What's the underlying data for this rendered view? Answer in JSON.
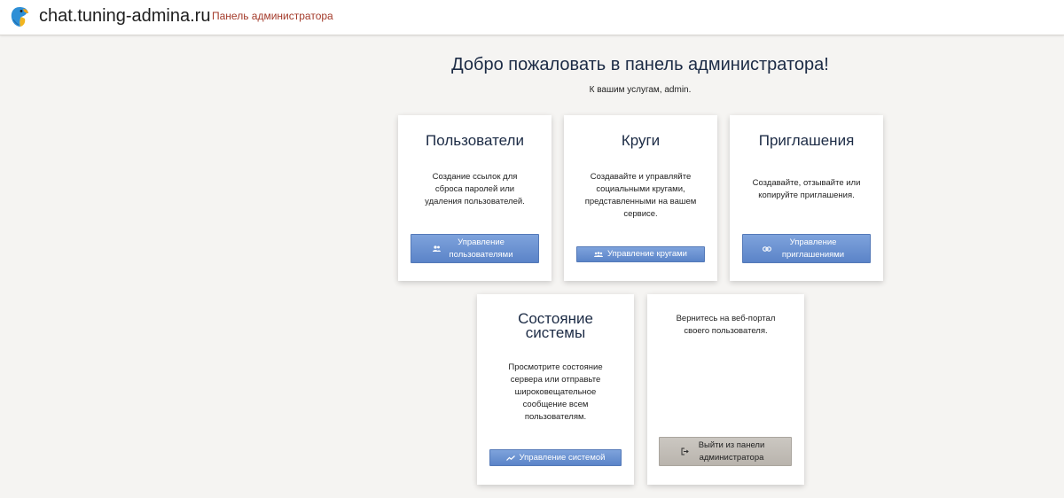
{
  "header": {
    "site_title": "chat.tuning-admina.ru",
    "admin_link": "Панель администратора",
    "logo_icon": "parrot-logo-icon"
  },
  "main": {
    "welcome": "Добро пожаловать в панель администратора!",
    "subtitle": "К вашим услугам, admin."
  },
  "cards": {
    "users": {
      "title": "Пользователи",
      "description": "Создание ссылок для сброса паролей или удаления пользователей.",
      "button": "Управление пользователями",
      "icon": "users-icon"
    },
    "circles": {
      "title": "Круги",
      "description": "Создавайте и управляйте социальными кругами, представленными на вашем сервисе.",
      "button": "Управление кругами",
      "icon": "groups-icon"
    },
    "invites": {
      "title": "Приглашения",
      "description": "Создавайте, отзывайте или копируйте приглашения.",
      "button": "Управление приглашениями",
      "icon": "link-icon"
    },
    "system": {
      "title": "Состояние системы",
      "description": "Просмотрите состояние сервера или отправьте широковещательное сообщение всем пользователям.",
      "button": "Управление системой",
      "icon": "chart-icon"
    },
    "exit": {
      "description": "Вернитесь на веб-портал своего пользователя.",
      "button": "Выйти из панели администратора",
      "icon": "logout-icon"
    }
  },
  "colors": {
    "accent_link": "#a33a2a",
    "button_blue": "#6a92d4",
    "button_grey": "#c4bfb8",
    "heading": "#1c2b45",
    "background": "#f5f4f2"
  }
}
